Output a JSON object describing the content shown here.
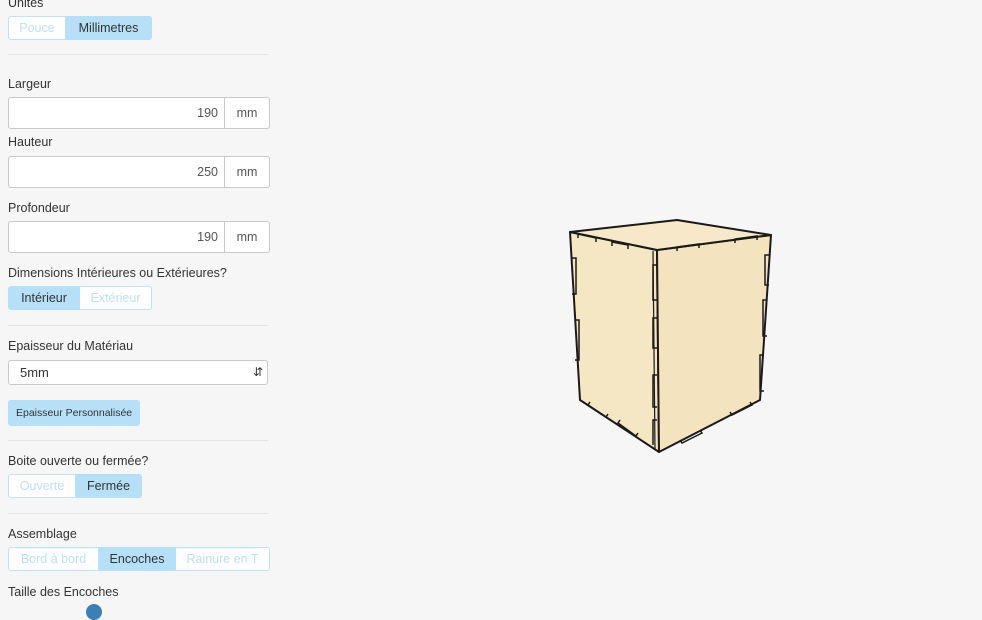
{
  "units": {
    "label": "Unités",
    "options": [
      "Pouce",
      "Millimetres"
    ],
    "selected": "Millimetres"
  },
  "width": {
    "label": "Largeur",
    "value": "190",
    "unit": "mm"
  },
  "height": {
    "label": "Hauteur",
    "value": "250",
    "unit": "mm"
  },
  "depth": {
    "label": "Profondeur",
    "value": "190",
    "unit": "mm"
  },
  "dimensions": {
    "label": "Dimensions Intérieures ou Extérieures?",
    "options": [
      "Intérieur",
      "Extérieur"
    ],
    "selected": "Intérieur"
  },
  "material": {
    "label": "Epaisseur du Matériau",
    "value": "5mm",
    "custom_button": "Epaisseur Personnalisée"
  },
  "box_type": {
    "label": "Boite ouverte ou fermée?",
    "options": [
      "Ouverte",
      "Fermée"
    ],
    "selected": "Fermée"
  },
  "assembly": {
    "label": "Assemblage",
    "options": [
      "Bord à bord",
      "Encoches",
      "Rainure en T"
    ],
    "selected": "Encoches"
  },
  "notch_size": {
    "label": "Taille des Encoches"
  },
  "colors": {
    "accent": "#b6e0f7",
    "wood": "#f5e6c4",
    "slider": "#3a7fb5"
  }
}
